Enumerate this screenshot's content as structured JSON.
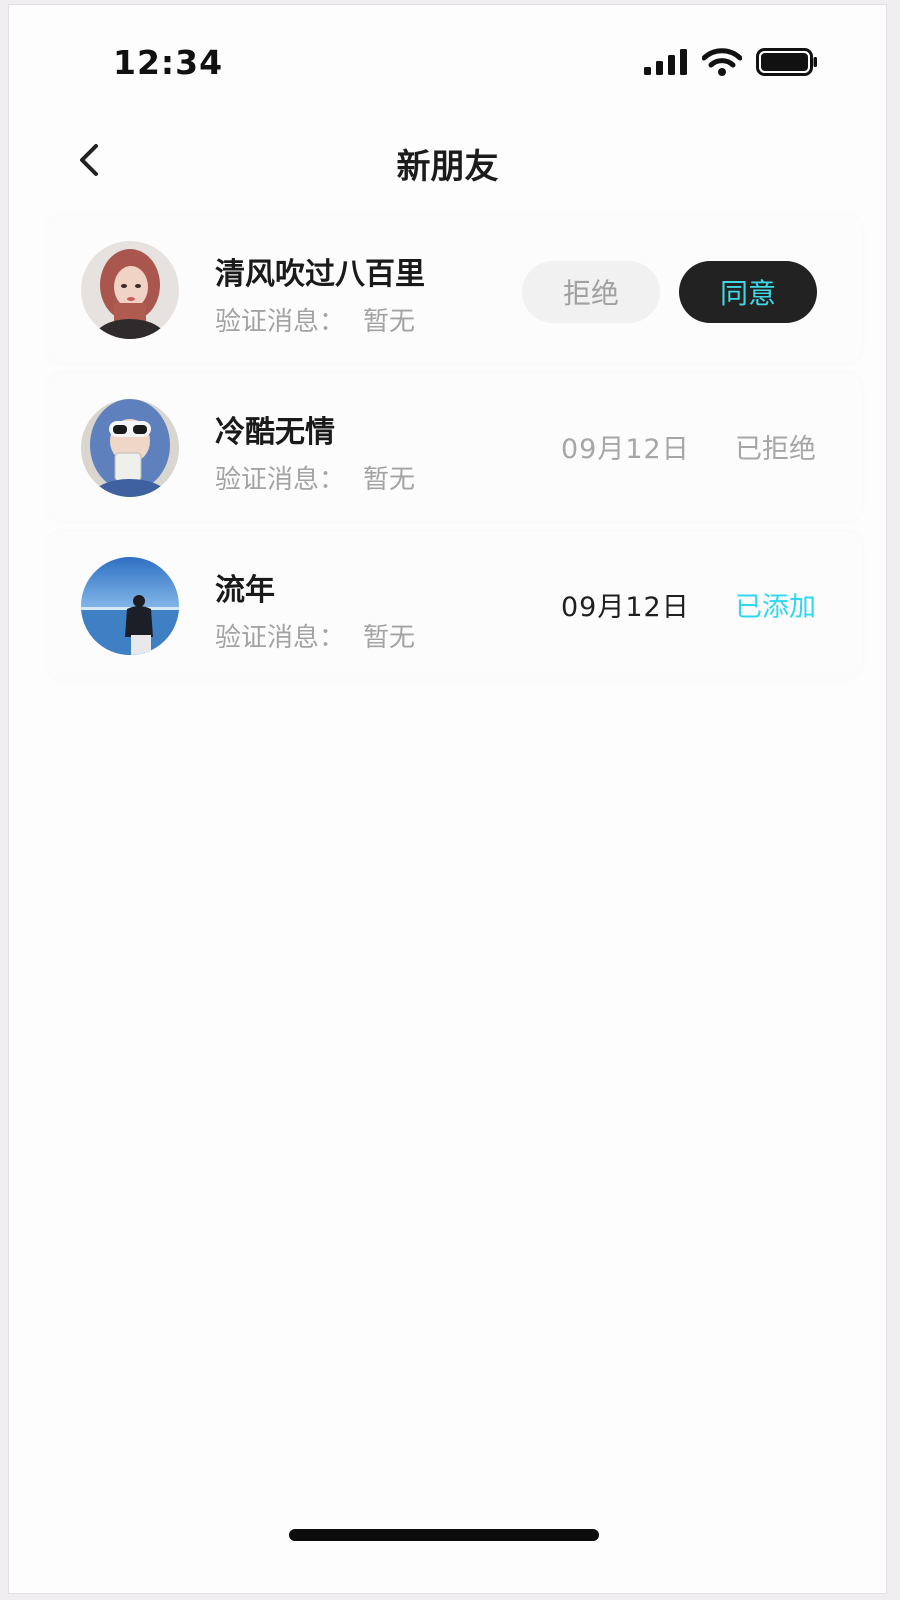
{
  "status_bar": {
    "time": "12:34",
    "icons": [
      "signal-icon",
      "wifi-icon",
      "battery-icon"
    ]
  },
  "nav": {
    "back_icon": "chevron-left-icon",
    "title": "新朋友"
  },
  "requests": [
    {
      "name": "清风吹过八百里",
      "verify_label": "验证消息：",
      "verify_value": "暂无",
      "reject_label": "拒绝",
      "accept_label": "同意"
    },
    {
      "name": "冷酷无情",
      "verify_label": "验证消息：",
      "verify_value": "暂无",
      "date": "09月12日",
      "status": "已拒绝"
    },
    {
      "name": "流年",
      "verify_label": "验证消息：",
      "verify_value": "暂无",
      "date": "09月12日",
      "status": "已添加"
    }
  ],
  "colors": {
    "accent": "#2ed8f1",
    "accept_bg": "#222222",
    "reject_bg": "#f1f1f1",
    "muted_text": "#a3a3a3"
  }
}
